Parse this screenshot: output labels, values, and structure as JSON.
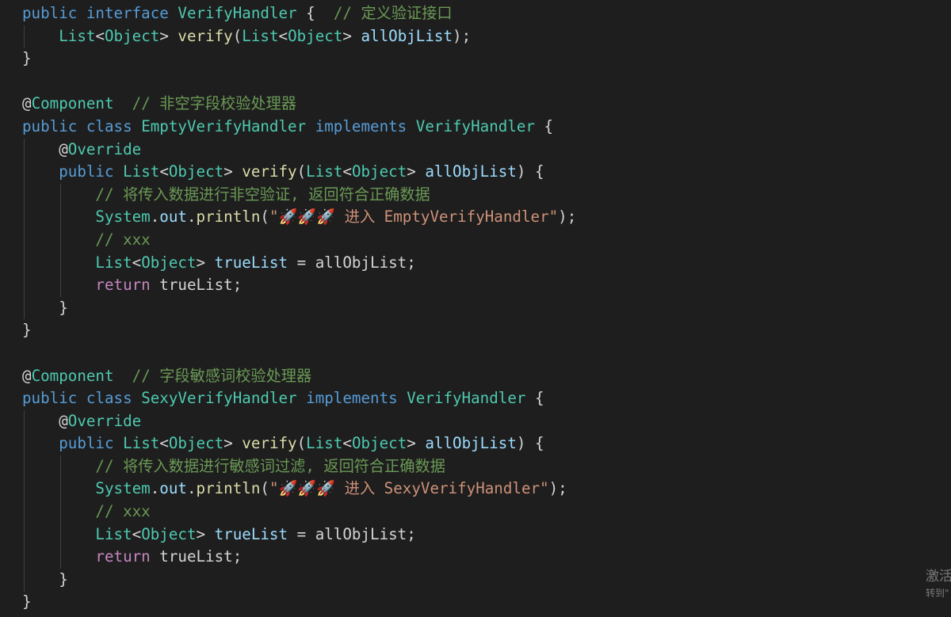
{
  "editor": {
    "theme_colors": {
      "background": "#1e1e1e",
      "keyword": "#569cd6",
      "control": "#c586c0",
      "type": "#4ec9b0",
      "function": "#dcdcaa",
      "variable": "#9cdcfe",
      "string": "#ce9178",
      "comment": "#6a9955",
      "plain": "#d4d4d4",
      "indent_guide": "#404040"
    },
    "code_lines": [
      {
        "tokens": [
          {
            "t": "public",
            "c": "kw"
          },
          {
            "t": " ",
            "c": "plain"
          },
          {
            "t": "interface",
            "c": "kw"
          },
          {
            "t": " ",
            "c": "plain"
          },
          {
            "t": "VerifyHandler",
            "c": "type"
          },
          {
            "t": " {  ",
            "c": "plain"
          },
          {
            "t": "// 定义验证接口",
            "c": "cmt"
          }
        ]
      },
      {
        "tokens": [
          {
            "t": "    ",
            "c": "plain"
          },
          {
            "t": "List",
            "c": "type"
          },
          {
            "t": "<",
            "c": "plain"
          },
          {
            "t": "Object",
            "c": "type"
          },
          {
            "t": "> ",
            "c": "plain"
          },
          {
            "t": "verify",
            "c": "fn"
          },
          {
            "t": "(",
            "c": "plain"
          },
          {
            "t": "List",
            "c": "type"
          },
          {
            "t": "<",
            "c": "plain"
          },
          {
            "t": "Object",
            "c": "type"
          },
          {
            "t": "> ",
            "c": "plain"
          },
          {
            "t": "allObjList",
            "c": "var"
          },
          {
            "t": ");",
            "c": "plain"
          }
        ]
      },
      {
        "tokens": [
          {
            "t": "}",
            "c": "plain"
          }
        ]
      },
      {
        "tokens": []
      },
      {
        "tokens": [
          {
            "t": "@",
            "c": "plain"
          },
          {
            "t": "Component",
            "c": "type"
          },
          {
            "t": "  ",
            "c": "plain"
          },
          {
            "t": "// 非空字段校验处理器",
            "c": "cmt"
          }
        ]
      },
      {
        "tokens": [
          {
            "t": "public",
            "c": "kw"
          },
          {
            "t": " ",
            "c": "plain"
          },
          {
            "t": "class",
            "c": "kw"
          },
          {
            "t": " ",
            "c": "plain"
          },
          {
            "t": "EmptyVerifyHandler",
            "c": "type"
          },
          {
            "t": " ",
            "c": "plain"
          },
          {
            "t": "implements",
            "c": "kw"
          },
          {
            "t": " ",
            "c": "plain"
          },
          {
            "t": "VerifyHandler",
            "c": "type"
          },
          {
            "t": " {",
            "c": "plain"
          }
        ]
      },
      {
        "tokens": [
          {
            "t": "    ",
            "c": "plain"
          },
          {
            "t": "@",
            "c": "plain"
          },
          {
            "t": "Override",
            "c": "type"
          }
        ]
      },
      {
        "tokens": [
          {
            "t": "    ",
            "c": "plain"
          },
          {
            "t": "public",
            "c": "kw"
          },
          {
            "t": " ",
            "c": "plain"
          },
          {
            "t": "List",
            "c": "type"
          },
          {
            "t": "<",
            "c": "plain"
          },
          {
            "t": "Object",
            "c": "type"
          },
          {
            "t": "> ",
            "c": "plain"
          },
          {
            "t": "verify",
            "c": "fn"
          },
          {
            "t": "(",
            "c": "plain"
          },
          {
            "t": "List",
            "c": "type"
          },
          {
            "t": "<",
            "c": "plain"
          },
          {
            "t": "Object",
            "c": "type"
          },
          {
            "t": "> ",
            "c": "plain"
          },
          {
            "t": "allObjList",
            "c": "var"
          },
          {
            "t": ") {",
            "c": "plain"
          }
        ]
      },
      {
        "tokens": [
          {
            "t": "        ",
            "c": "plain"
          },
          {
            "t": "// 将传入数据进行非空验证, 返回符合正确数据",
            "c": "cmt"
          }
        ]
      },
      {
        "tokens": [
          {
            "t": "        ",
            "c": "plain"
          },
          {
            "t": "System",
            "c": "type"
          },
          {
            "t": ".",
            "c": "plain"
          },
          {
            "t": "out",
            "c": "var"
          },
          {
            "t": ".",
            "c": "plain"
          },
          {
            "t": "println",
            "c": "fn"
          },
          {
            "t": "(",
            "c": "plain"
          },
          {
            "t": "\"",
            "c": "str"
          },
          {
            "t": "🚀🚀🚀",
            "c": "emoji"
          },
          {
            "t": " 进入 EmptyVerifyHandler\"",
            "c": "str"
          },
          {
            "t": ");",
            "c": "plain"
          }
        ]
      },
      {
        "tokens": [
          {
            "t": "        ",
            "c": "plain"
          },
          {
            "t": "// xxx",
            "c": "cmt"
          }
        ]
      },
      {
        "tokens": [
          {
            "t": "        ",
            "c": "plain"
          },
          {
            "t": "List",
            "c": "type"
          },
          {
            "t": "<",
            "c": "plain"
          },
          {
            "t": "Object",
            "c": "type"
          },
          {
            "t": "> ",
            "c": "plain"
          },
          {
            "t": "trueList",
            "c": "var"
          },
          {
            "t": " = allObjList;",
            "c": "plain"
          }
        ]
      },
      {
        "tokens": [
          {
            "t": "        ",
            "c": "plain"
          },
          {
            "t": "return",
            "c": "ctrl"
          },
          {
            "t": " trueList;",
            "c": "plain"
          }
        ]
      },
      {
        "tokens": [
          {
            "t": "    ",
            "c": "plain"
          },
          {
            "t": "}",
            "c": "plain"
          }
        ]
      },
      {
        "tokens": [
          {
            "t": "}",
            "c": "plain"
          }
        ]
      },
      {
        "tokens": []
      },
      {
        "tokens": [
          {
            "t": "@",
            "c": "plain"
          },
          {
            "t": "Component",
            "c": "type"
          },
          {
            "t": "  ",
            "c": "plain"
          },
          {
            "t": "// 字段敏感词校验处理器",
            "c": "cmt"
          }
        ]
      },
      {
        "tokens": [
          {
            "t": "public",
            "c": "kw"
          },
          {
            "t": " ",
            "c": "plain"
          },
          {
            "t": "class",
            "c": "kw"
          },
          {
            "t": " ",
            "c": "plain"
          },
          {
            "t": "SexyVerifyHandler",
            "c": "type"
          },
          {
            "t": " ",
            "c": "plain"
          },
          {
            "t": "implements",
            "c": "kw"
          },
          {
            "t": " ",
            "c": "plain"
          },
          {
            "t": "VerifyHandler",
            "c": "type"
          },
          {
            "t": " {",
            "c": "plain"
          }
        ]
      },
      {
        "tokens": [
          {
            "t": "    ",
            "c": "plain"
          },
          {
            "t": "@",
            "c": "plain"
          },
          {
            "t": "Override",
            "c": "type"
          }
        ]
      },
      {
        "tokens": [
          {
            "t": "    ",
            "c": "plain"
          },
          {
            "t": "public",
            "c": "kw"
          },
          {
            "t": " ",
            "c": "plain"
          },
          {
            "t": "List",
            "c": "type"
          },
          {
            "t": "<",
            "c": "plain"
          },
          {
            "t": "Object",
            "c": "type"
          },
          {
            "t": "> ",
            "c": "plain"
          },
          {
            "t": "verify",
            "c": "fn"
          },
          {
            "t": "(",
            "c": "plain"
          },
          {
            "t": "List",
            "c": "type"
          },
          {
            "t": "<",
            "c": "plain"
          },
          {
            "t": "Object",
            "c": "type"
          },
          {
            "t": "> ",
            "c": "plain"
          },
          {
            "t": "allObjList",
            "c": "var"
          },
          {
            "t": ") {",
            "c": "plain"
          }
        ]
      },
      {
        "tokens": [
          {
            "t": "        ",
            "c": "plain"
          },
          {
            "t": "// 将传入数据进行敏感词过滤, 返回符合正确数据",
            "c": "cmt"
          }
        ]
      },
      {
        "tokens": [
          {
            "t": "        ",
            "c": "plain"
          },
          {
            "t": "System",
            "c": "type"
          },
          {
            "t": ".",
            "c": "plain"
          },
          {
            "t": "out",
            "c": "var"
          },
          {
            "t": ".",
            "c": "plain"
          },
          {
            "t": "println",
            "c": "fn"
          },
          {
            "t": "(",
            "c": "plain"
          },
          {
            "t": "\"",
            "c": "str"
          },
          {
            "t": "🚀🚀🚀",
            "c": "emoji"
          },
          {
            "t": " 进入 SexyVerifyHandler\"",
            "c": "str"
          },
          {
            "t": ");",
            "c": "plain"
          }
        ]
      },
      {
        "tokens": [
          {
            "t": "        ",
            "c": "plain"
          },
          {
            "t": "// xxx",
            "c": "cmt"
          }
        ]
      },
      {
        "tokens": [
          {
            "t": "        ",
            "c": "plain"
          },
          {
            "t": "List",
            "c": "type"
          },
          {
            "t": "<",
            "c": "plain"
          },
          {
            "t": "Object",
            "c": "type"
          },
          {
            "t": "> ",
            "c": "plain"
          },
          {
            "t": "trueList",
            "c": "var"
          },
          {
            "t": " = allObjList;",
            "c": "plain"
          }
        ]
      },
      {
        "tokens": [
          {
            "t": "        ",
            "c": "plain"
          },
          {
            "t": "return",
            "c": "ctrl"
          },
          {
            "t": " trueList;",
            "c": "plain"
          }
        ]
      },
      {
        "tokens": [
          {
            "t": "    ",
            "c": "plain"
          },
          {
            "t": "}",
            "c": "plain"
          }
        ]
      },
      {
        "tokens": [
          {
            "t": "}",
            "c": "plain"
          }
        ]
      }
    ]
  },
  "watermark": {
    "title": "激活",
    "subtitle": "转到\""
  }
}
